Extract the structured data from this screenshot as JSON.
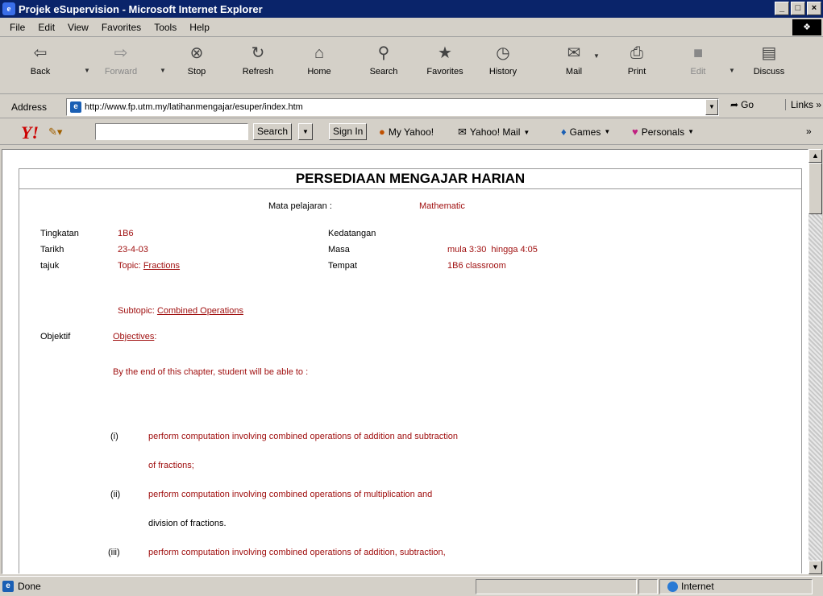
{
  "window": {
    "title": "Projek eSupervision - Microsoft Internet Explorer",
    "controls": [
      "_",
      "□",
      "×"
    ]
  },
  "menu": [
    "File",
    "Edit",
    "View",
    "Favorites",
    "Tools",
    "Help"
  ],
  "toolbar": {
    "back": "Back",
    "forward": "Forward",
    "stop": "Stop",
    "refresh": "Refresh",
    "home": "Home",
    "search": "Search",
    "favorites": "Favorites",
    "history": "History",
    "mail": "Mail",
    "print": "Print",
    "edit": "Edit",
    "discuss": "Discuss"
  },
  "address": {
    "label": "Address",
    "url": "http://www.fp.utm.my/latihanmengajar/esuper/index.htm",
    "go": "Go",
    "links": "Links"
  },
  "yahoo": {
    "logo": "Y!",
    "search_button": "Search",
    "sign_in": "Sign In",
    "my_yahoo": "My Yahoo!",
    "yahoo_mail": "Yahoo! Mail",
    "games": "Games",
    "personals": "Personals"
  },
  "page": {
    "heading": "PERSEDIAAN MENGAJAR HARIAN",
    "subject_label": "Mata pelajaran :",
    "subject_value": "Mathematic",
    "form_label": "Tingkatan",
    "form_value": "1B6",
    "attendance_label": "Kedatangan",
    "date_label": "Tarikh",
    "date_value": "23-4-03",
    "time_label": "Masa",
    "time_value": "mula 3:30  hingga 4:05",
    "title_label": "tajuk",
    "topic_prefix": "Topic:",
    "topic_value": "Fractions",
    "place_label": "Tempat",
    "place_value": "1B6 classroom",
    "subtopic_prefix": "Subtopic:",
    "subtopic_value": "Combined Operations",
    "objective_label": "Objektif",
    "objectives_heading": "Objectives",
    "objectives_suffix": ":",
    "intro": "By the end of this chapter, student will be able to :",
    "items": [
      {
        "num": "(i)",
        "line1": "perform computation involving combined operations of addition and subtraction",
        "line2": "of fractions;"
      },
      {
        "num": "(ii)",
        "line1": "perform computation involving combined operations of multiplication and",
        "line2": "division of fractions."
      },
      {
        "num": "(iii)",
        "line1": "perform computation involving combined operations of addition, subtraction,",
        "line2": ""
      }
    ]
  },
  "status": {
    "text": "Done",
    "zone": "Internet"
  }
}
